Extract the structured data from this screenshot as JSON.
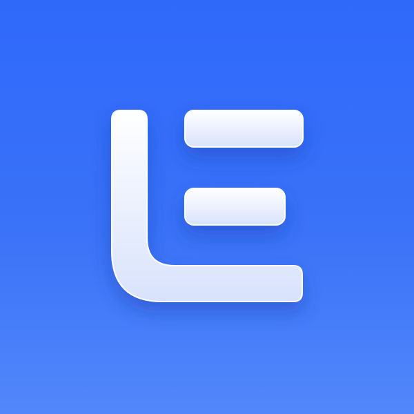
{
  "app_icon": {
    "icon_name": "le-logo-icon",
    "colors": {
      "background_top": "#2f69fa",
      "background_bottom": "#5287fa",
      "glyph_top": "#ffffff",
      "glyph_bottom": "#d8e2fb",
      "glyph_stroke": "#ffffff",
      "shadow": "#1a3fb0"
    }
  }
}
